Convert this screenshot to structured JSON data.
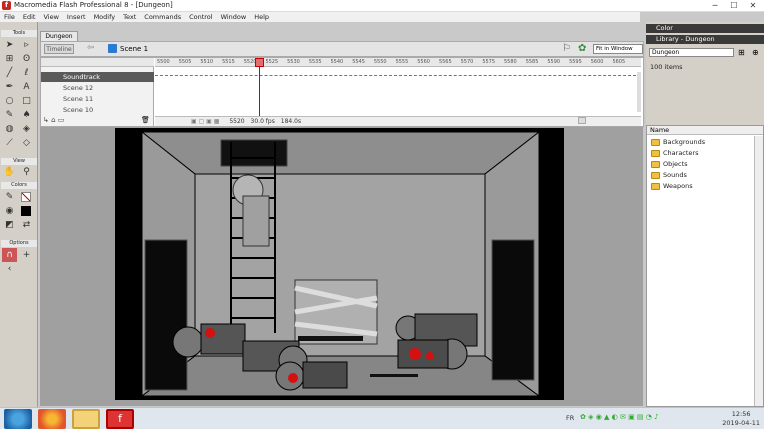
{
  "window": {
    "title": "Macromedia Flash Professional 8 - [Dungeon]",
    "icon": "f",
    "min": "─",
    "max": "☐",
    "close": "✕"
  },
  "menu": [
    "File",
    "Edit",
    "View",
    "Insert",
    "Modify",
    "Text",
    "Commands",
    "Control",
    "Window",
    "Help"
  ],
  "tools": {
    "header": "Tools",
    "view_header": "View",
    "colors_header": "Colors",
    "options_header": "Options"
  },
  "document": {
    "tab": "Dungeon",
    "timeline_btn": "Timeline",
    "scene": "Scene 1",
    "zoom": "Fit in Window"
  },
  "timeline": {
    "layers": [
      {
        "name": "Soundtrack",
        "selected": true
      },
      {
        "name": "Scene 12"
      },
      {
        "name": "Scene 11"
      },
      {
        "name": "Scene 10"
      }
    ],
    "ruler": [
      "5500",
      "5505",
      "5510",
      "5515",
      "5520",
      "5525",
      "5530",
      "5535",
      "5540",
      "5545",
      "5550",
      "5555",
      "5560",
      "5565",
      "5570",
      "5575",
      "5580",
      "5585",
      "5590",
      "5595",
      "5600",
      "5605"
    ],
    "frame": "5520",
    "fps": "30.0 fps",
    "time": "184.0s"
  },
  "panels": {
    "color": "Color",
    "library": "Library - Dungeon",
    "library_doc": "Dungeon",
    "items_count": "100 items",
    "name_col": "Name"
  },
  "library_items": [
    "Backgrounds",
    "Characters",
    "Objects",
    "Sounds",
    "Weapons"
  ],
  "taskbar": {
    "lang": "FR",
    "time": "12:56",
    "date": "2019-04-11"
  },
  "colors": {
    "accent": "#c00000",
    "panel_dark": "#3a3a3a",
    "folder": "#f0c040",
    "blood": "#d41010"
  }
}
